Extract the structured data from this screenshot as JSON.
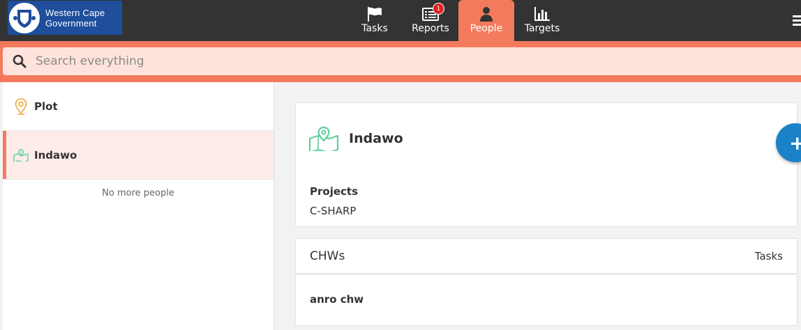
{
  "header": {
    "logo_line1": "Western Cape",
    "logo_line2": "Government",
    "brand_color": "#1e4e9c",
    "accent_color": "#f47a5e",
    "nav": [
      {
        "label": "Tasks",
        "icon": "flag-icon"
      },
      {
        "label": "Reports",
        "icon": "reports-icon",
        "badge": "1"
      },
      {
        "label": "People",
        "icon": "person-icon",
        "active": true
      },
      {
        "label": "Targets",
        "icon": "bar-chart-icon"
      }
    ]
  },
  "search": {
    "placeholder": "Search everything"
  },
  "people_list": {
    "items": [
      {
        "label": "Plot",
        "icon": "map-pin-icon"
      },
      {
        "label": "Indawo",
        "icon": "map-icon",
        "selected": true
      }
    ],
    "footer": "No more people"
  },
  "detail": {
    "title": "Indawo",
    "projects_label": "Projects",
    "projects_value": "C-SHARP",
    "chws_header": "CHWs",
    "tasks_header": "Tasks",
    "chw_name": "anro chw",
    "fab_label": "+"
  }
}
